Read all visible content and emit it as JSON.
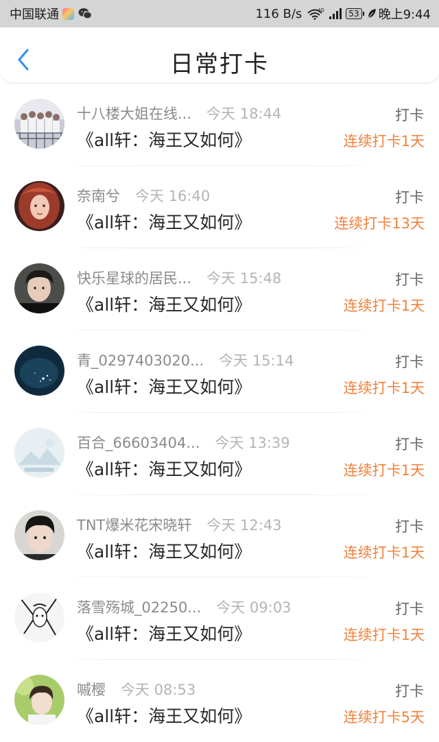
{
  "status_bar": {
    "carrier": "中国联通",
    "net_speed": "116 B/s",
    "network_type": "4G",
    "battery": "53",
    "time": "晚上9:44"
  },
  "header": {
    "title": "日常打卡",
    "back_icon": "chevron-left-icon",
    "accent_color": "#2e8ff0"
  },
  "colors": {
    "streak": "#f0823c",
    "username": "#8a8a8a",
    "time": "#b4b4b4"
  },
  "entries": [
    {
      "username": "十八楼大姐在线...",
      "time": "今天 18:44",
      "book": "《all轩：海王又如何》",
      "action": "打卡",
      "streak": "连续打卡1天"
    },
    {
      "username": "奈南兮",
      "time": "今天 16:40",
      "book": "《all轩：海王又如何》",
      "action": "打卡",
      "streak": "连续打卡13天"
    },
    {
      "username": "快乐星球的居民...",
      "time": "今天 15:48",
      "book": "《all轩：海王又如何》",
      "action": "打卡",
      "streak": "连续打卡1天"
    },
    {
      "username": "青_0297403020...",
      "time": "今天 15:14",
      "book": "《all轩：海王又如何》",
      "action": "打卡",
      "streak": "连续打卡1天"
    },
    {
      "username": "百合_66603404...",
      "time": "今天 13:39",
      "book": "《all轩：海王又如何》",
      "action": "打卡",
      "streak": "连续打卡1天"
    },
    {
      "username": "TNT爆米花宋晓轩",
      "time": "今天 12:43",
      "book": "《all轩：海王又如何》",
      "action": "打卡",
      "streak": "连续打卡1天"
    },
    {
      "username": "落雪殇城_02250...",
      "time": "今天 09:03",
      "book": "《all轩：海王又如何》",
      "action": "打卡",
      "streak": "连续打卡1天"
    },
    {
      "username": "嘁樱",
      "time": "今天 08:53",
      "book": "《all轩：海王又如何》",
      "action": "打卡",
      "streak": "连续打卡5天"
    }
  ]
}
